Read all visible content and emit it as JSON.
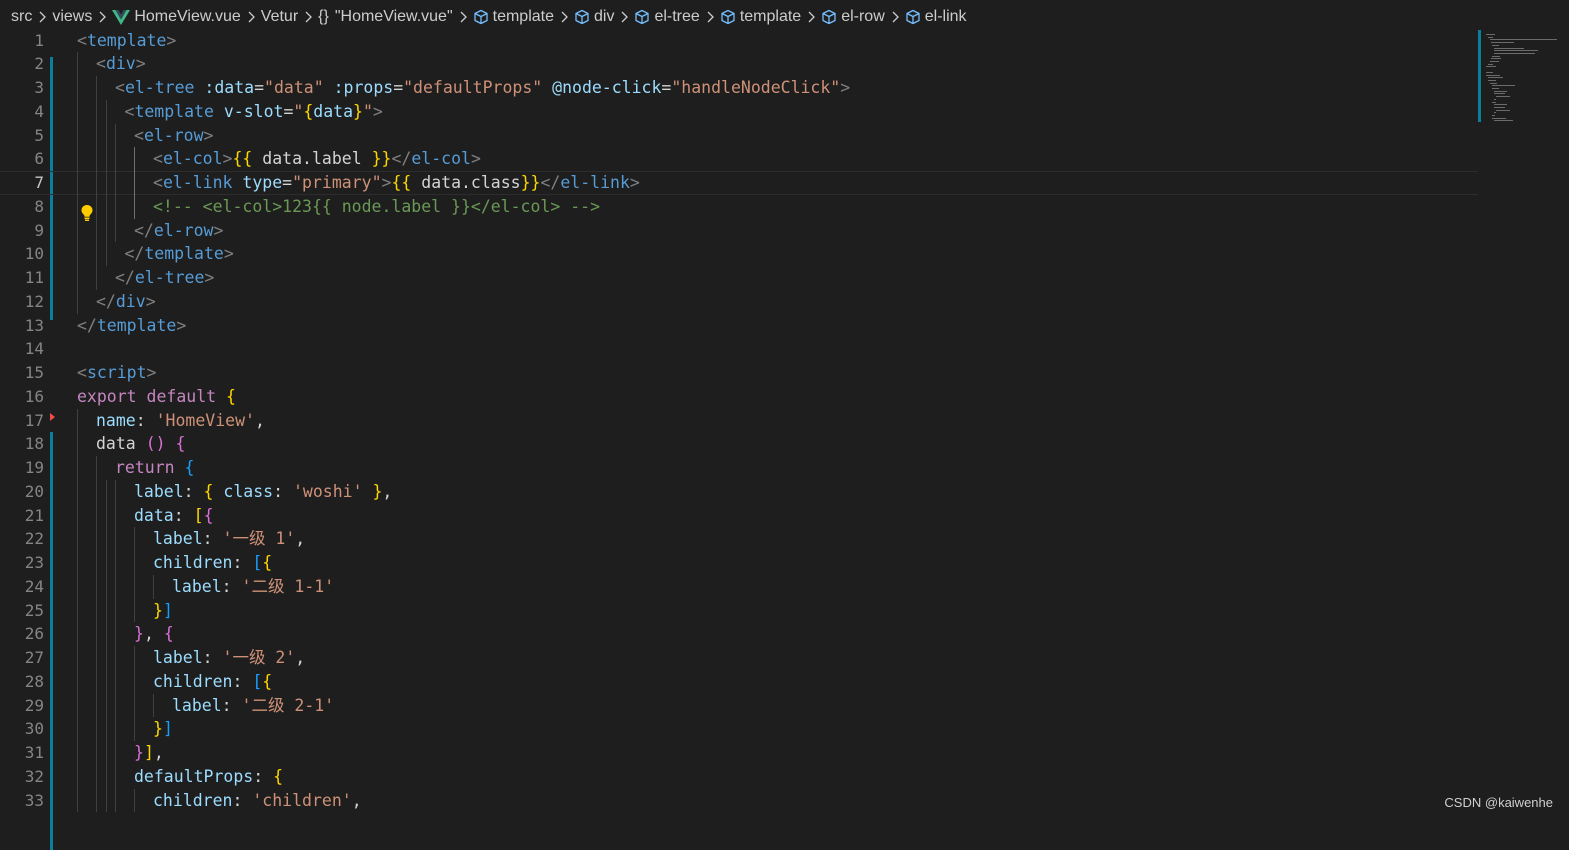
{
  "breadcrumb": {
    "items": [
      {
        "label": "src",
        "icon": "none"
      },
      {
        "label": "views",
        "icon": "none"
      },
      {
        "label": "HomeView.vue",
        "icon": "vue-icon"
      },
      {
        "label": "Vetur",
        "icon": "none"
      },
      {
        "label": "\"HomeView.vue\"",
        "icon": "braces-icon",
        "icon_text": "{}"
      },
      {
        "label": "template",
        "icon": "cube-icon"
      },
      {
        "label": "div",
        "icon": "cube-icon"
      },
      {
        "label": "el-tree",
        "icon": "cube-icon"
      },
      {
        "label": "template",
        "icon": "cube-icon"
      },
      {
        "label": "el-row",
        "icon": "cube-icon"
      },
      {
        "label": "el-link",
        "icon": "cube-icon"
      }
    ]
  },
  "editor": {
    "current_line": 7,
    "lightbulb_line": 7,
    "lines": [
      {
        "n": "1",
        "indent": 0,
        "tokens": [
          [
            "<",
            "punct"
          ],
          [
            "template",
            "tag"
          ],
          [
            ">",
            "punct"
          ]
        ]
      },
      {
        "n": "2",
        "indent": 1,
        "tokens": [
          [
            "<",
            "punct"
          ],
          [
            "div",
            "tag"
          ],
          [
            ">",
            "punct"
          ]
        ]
      },
      {
        "n": "3",
        "indent": 2,
        "tokens": [
          [
            "<",
            "punct"
          ],
          [
            "el-tree",
            "tag"
          ],
          [
            " ",
            "txt"
          ],
          [
            ":data",
            "attr"
          ],
          [
            "=",
            "txt"
          ],
          [
            "\"data\"",
            "str"
          ],
          [
            " ",
            "txt"
          ],
          [
            ":props",
            "attr"
          ],
          [
            "=",
            "txt"
          ],
          [
            "\"defaultProps\"",
            "str"
          ],
          [
            " ",
            "txt"
          ],
          [
            "@node-click",
            "attr"
          ],
          [
            "=",
            "txt"
          ],
          [
            "\"handleNodeClick\"",
            "str"
          ],
          [
            ">",
            "punct"
          ]
        ]
      },
      {
        "n": "4",
        "indent": 2.5,
        "tokens": [
          [
            "<",
            "punct"
          ],
          [
            "template",
            "tag"
          ],
          [
            " ",
            "txt"
          ],
          [
            "v-slot",
            "attr"
          ],
          [
            "=",
            "txt"
          ],
          [
            "\"",
            "str"
          ],
          [
            "{",
            "b1"
          ],
          [
            "data",
            "prop"
          ],
          [
            "}",
            "b1"
          ],
          [
            "\"",
            "str"
          ],
          [
            ">",
            "punct"
          ]
        ]
      },
      {
        "n": "5",
        "indent": 3,
        "tokens": [
          [
            "<",
            "punct"
          ],
          [
            "el-row",
            "tag"
          ],
          [
            ">",
            "punct"
          ]
        ]
      },
      {
        "n": "6",
        "indent": 4,
        "tokens": [
          [
            "<",
            "punct"
          ],
          [
            "el-col",
            "tag"
          ],
          [
            ">",
            "punct"
          ],
          [
            "{{",
            "b1"
          ],
          [
            " data.label ",
            "txt"
          ],
          [
            "}}",
            "b1"
          ],
          [
            "</",
            "punct"
          ],
          [
            "el-col",
            "tag"
          ],
          [
            ">",
            "punct"
          ]
        ]
      },
      {
        "n": "7",
        "indent": 4,
        "tokens": [
          [
            "<",
            "punct"
          ],
          [
            "el-link",
            "tag"
          ],
          [
            " ",
            "txt"
          ],
          [
            "type",
            "attr"
          ],
          [
            "=",
            "txt"
          ],
          [
            "\"primary\"",
            "str"
          ],
          [
            ">",
            "punct"
          ],
          [
            "{{",
            "b1"
          ],
          [
            " data.class",
            "txt"
          ],
          [
            "}}",
            "b1"
          ],
          [
            "</",
            "punct"
          ],
          [
            "el-link",
            "tag"
          ],
          [
            ">",
            "punct"
          ]
        ]
      },
      {
        "n": "8",
        "indent": 4,
        "tokens": [
          [
            "<!-- <el-col>123{{ node.label }}</el-col> -->",
            "com"
          ]
        ]
      },
      {
        "n": "9",
        "indent": 3,
        "tokens": [
          [
            "</",
            "punct"
          ],
          [
            "el-row",
            "tag"
          ],
          [
            ">",
            "punct"
          ]
        ]
      },
      {
        "n": "10",
        "indent": 2.5,
        "tokens": [
          [
            "</",
            "punct"
          ],
          [
            "template",
            "tag"
          ],
          [
            ">",
            "punct"
          ]
        ]
      },
      {
        "n": "11",
        "indent": 2,
        "tokens": [
          [
            "</",
            "punct"
          ],
          [
            "el-tree",
            "tag"
          ],
          [
            ">",
            "punct"
          ]
        ]
      },
      {
        "n": "12",
        "indent": 1,
        "tokens": [
          [
            "</",
            "punct"
          ],
          [
            "div",
            "tag"
          ],
          [
            ">",
            "punct"
          ]
        ]
      },
      {
        "n": "13",
        "indent": 0,
        "tokens": [
          [
            "</",
            "punct"
          ],
          [
            "template",
            "tag"
          ],
          [
            ">",
            "punct"
          ]
        ]
      },
      {
        "n": "14",
        "indent": 0,
        "tokens": []
      },
      {
        "n": "15",
        "indent": 0,
        "tokens": [
          [
            "<",
            "punct"
          ],
          [
            "script",
            "tag"
          ],
          [
            ">",
            "punct"
          ]
        ]
      },
      {
        "n": "16",
        "indent": 0,
        "tokens": [
          [
            "export",
            "ctrl"
          ],
          [
            " ",
            "txt"
          ],
          [
            "default",
            "ctrl"
          ],
          [
            " ",
            "txt"
          ],
          [
            "{",
            "b1"
          ]
        ]
      },
      {
        "n": "17",
        "indent": 1,
        "tokens": [
          [
            "name",
            "prop"
          ],
          [
            ": ",
            "txt"
          ],
          [
            "'HomeView'",
            "str"
          ],
          [
            ",",
            "txt"
          ]
        ]
      },
      {
        "n": "18",
        "indent": 1,
        "tokens": [
          [
            "data",
            "txt"
          ],
          [
            " ",
            "txt"
          ],
          [
            "()",
            "b2"
          ],
          [
            " ",
            "txt"
          ],
          [
            "{",
            "b2"
          ]
        ]
      },
      {
        "n": "19",
        "indent": 2,
        "tokens": [
          [
            "return",
            "ctrl"
          ],
          [
            " ",
            "txt"
          ],
          [
            "{",
            "b3"
          ]
        ]
      },
      {
        "n": "20",
        "indent": 3,
        "tokens": [
          [
            "label",
            "prop"
          ],
          [
            ": ",
            "txt"
          ],
          [
            "{",
            "b1"
          ],
          [
            " ",
            "txt"
          ],
          [
            "class",
            "prop"
          ],
          [
            ": ",
            "txt"
          ],
          [
            "'woshi'",
            "str"
          ],
          [
            " ",
            "txt"
          ],
          [
            "}",
            "b1"
          ],
          [
            ",",
            "txt"
          ]
        ]
      },
      {
        "n": "21",
        "indent": 3,
        "tokens": [
          [
            "data",
            "prop"
          ],
          [
            ": ",
            "txt"
          ],
          [
            "[",
            "b1"
          ],
          [
            "{",
            "b2"
          ]
        ]
      },
      {
        "n": "22",
        "indent": 4,
        "tokens": [
          [
            "label",
            "prop"
          ],
          [
            ": ",
            "txt"
          ],
          [
            "'一级 1'",
            "str"
          ],
          [
            ",",
            "txt"
          ]
        ]
      },
      {
        "n": "23",
        "indent": 4,
        "tokens": [
          [
            "children",
            "prop"
          ],
          [
            ": ",
            "txt"
          ],
          [
            "[",
            "b3"
          ],
          [
            "{",
            "b1"
          ]
        ]
      },
      {
        "n": "24",
        "indent": 5,
        "tokens": [
          [
            "label",
            "prop"
          ],
          [
            ": ",
            "txt"
          ],
          [
            "'二级 1-1'",
            "str"
          ]
        ]
      },
      {
        "n": "25",
        "indent": 4,
        "tokens": [
          [
            "}",
            "b1"
          ],
          [
            "]",
            "b3"
          ]
        ]
      },
      {
        "n": "26",
        "indent": 3,
        "tokens": [
          [
            "}",
            "b2"
          ],
          [
            ", ",
            "txt"
          ],
          [
            "{",
            "b2"
          ]
        ]
      },
      {
        "n": "27",
        "indent": 4,
        "tokens": [
          [
            "label",
            "prop"
          ],
          [
            ": ",
            "txt"
          ],
          [
            "'一级 2'",
            "str"
          ],
          [
            ",",
            "txt"
          ]
        ]
      },
      {
        "n": "28",
        "indent": 4,
        "tokens": [
          [
            "children",
            "prop"
          ],
          [
            ": ",
            "txt"
          ],
          [
            "[",
            "b3"
          ],
          [
            "{",
            "b1"
          ]
        ]
      },
      {
        "n": "29",
        "indent": 5,
        "tokens": [
          [
            "label",
            "prop"
          ],
          [
            ": ",
            "txt"
          ],
          [
            "'二级 2-1'",
            "str"
          ]
        ]
      },
      {
        "n": "30",
        "indent": 4,
        "tokens": [
          [
            "}",
            "b1"
          ],
          [
            "]",
            "b3"
          ]
        ]
      },
      {
        "n": "31",
        "indent": 3,
        "tokens": [
          [
            "}",
            "b2"
          ],
          [
            "]",
            "b1"
          ],
          [
            ",",
            "txt"
          ]
        ]
      },
      {
        "n": "32",
        "indent": 3,
        "tokens": [
          [
            "defaultProps",
            "prop"
          ],
          [
            ": ",
            "txt"
          ],
          [
            "{",
            "b1"
          ]
        ]
      },
      {
        "n": "33",
        "indent": 4,
        "tokens": [
          [
            "children",
            "prop"
          ],
          [
            ": ",
            "txt"
          ],
          [
            "'children'",
            "str"
          ],
          [
            ",",
            "txt"
          ]
        ]
      }
    ]
  },
  "watermark": "CSDN @kaiwenhe",
  "colors": {
    "background": "#1e1e1e",
    "tag": "#569cd6",
    "attribute": "#9cdcfe",
    "string": "#ce9178",
    "keyword_control": "#c586c0",
    "comment": "#6a9955",
    "bracket_gold": "#ffd700",
    "bracket_orchid": "#da70d6",
    "bracket_blue": "#179fff",
    "gutter_modified": "#0c7d9d"
  }
}
